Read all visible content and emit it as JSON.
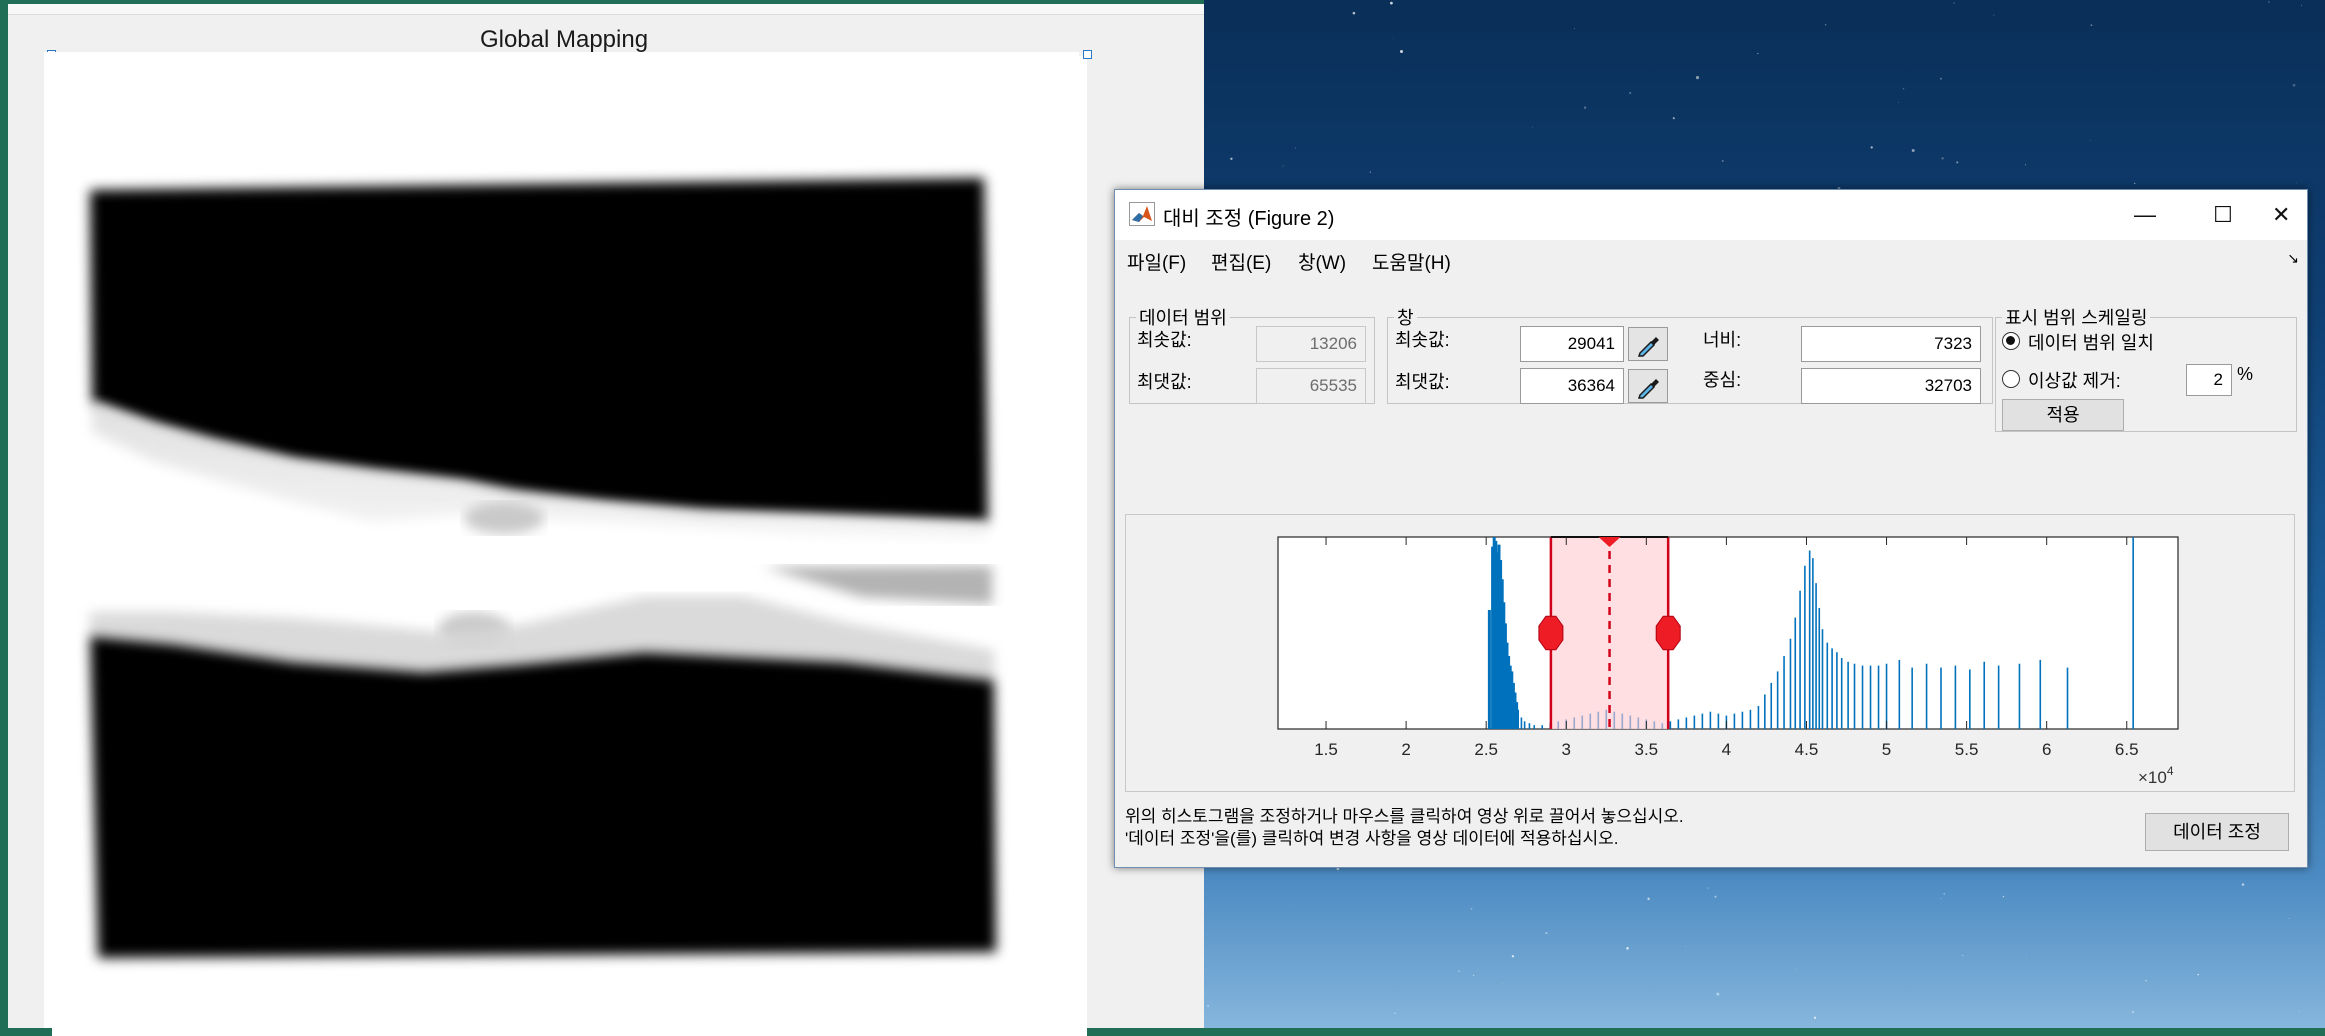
{
  "figure1": {
    "title": "Global Mapping"
  },
  "dialog": {
    "title": "대비 조정 (Figure 2)",
    "window_controls": {
      "minimize": "—",
      "maximize": "☐",
      "close": "✕"
    },
    "menu": [
      "파일(F)",
      "편집(E)",
      "창(W)",
      "도움말(H)"
    ],
    "data_range": {
      "legend": "데이터 범위",
      "min_label": "최솟값:",
      "min_value": "13206",
      "max_label": "최댓값:",
      "max_value": "65535"
    },
    "window": {
      "legend": "창",
      "min_label": "최솟값:",
      "min_value": "29041",
      "max_label": "최댓값:",
      "max_value": "36364",
      "width_label": "너비:",
      "width_value": "7323",
      "center_label": "중심:",
      "center_value": "32703"
    },
    "scaling": {
      "legend": "표시 범위 스케일링",
      "option1": "데이터 범위 일치",
      "option2": "이상값 제거:",
      "outlier_value": "2",
      "percent": "%",
      "apply": "적용",
      "selected": "option1"
    },
    "instructions": [
      "위의 히스토그램을 조정하거나 마우스를 클릭하여 영상 위로 끌어서 놓으십시오.",
      "'데이터 조정'을(를) 클릭하여 변경 사항을 영상 데이터에 적용하십시오."
    ],
    "adjust_button": "데이터 조정"
  },
  "chart_data": {
    "type": "bar",
    "title": "",
    "x_ticks": [
      "1.5",
      "2",
      "2.5",
      "3",
      "3.5",
      "4",
      "4.5",
      "5",
      "5.5",
      "6",
      "6.5"
    ],
    "x_multiplier": "×10",
    "x_multiplier_exp": "4",
    "xlim": [
      12000,
      68200
    ],
    "ylim": [
      0,
      1
    ],
    "window": {
      "min": 29041,
      "max": 36364,
      "center": 32703
    },
    "bar_color": "#0072bd",
    "window_color": "#d0021b",
    "series": [
      {
        "values_xy": [
          [
            25200,
            0.62
          ],
          [
            25400,
            0.95
          ],
          [
            25500,
            1.0
          ],
          [
            25600,
            0.98
          ],
          [
            25700,
            0.92
          ],
          [
            25800,
            0.96
          ],
          [
            25900,
            0.88
          ],
          [
            26000,
            0.78
          ],
          [
            26100,
            0.66
          ],
          [
            26200,
            0.55
          ],
          [
            26300,
            0.45
          ],
          [
            26400,
            0.38
          ],
          [
            26500,
            0.33
          ],
          [
            26600,
            0.3
          ],
          [
            26700,
            0.24
          ],
          [
            26800,
            0.19
          ],
          [
            26900,
            0.14
          ],
          [
            27000,
            0.1
          ],
          [
            27200,
            0.06
          ],
          [
            27400,
            0.04
          ],
          [
            27700,
            0.03
          ],
          [
            28000,
            0.02
          ],
          [
            28500,
            0.02
          ],
          [
            29000,
            0.03
          ],
          [
            29500,
            0.04
          ],
          [
            30000,
            0.05
          ],
          [
            30500,
            0.06
          ],
          [
            31000,
            0.07
          ],
          [
            31500,
            0.08
          ],
          [
            32000,
            0.09
          ],
          [
            32500,
            0.1
          ],
          [
            33000,
            0.09
          ],
          [
            33500,
            0.08
          ],
          [
            34000,
            0.07
          ],
          [
            34500,
            0.06
          ],
          [
            35000,
            0.05
          ],
          [
            35500,
            0.04
          ],
          [
            36000,
            0.03
          ],
          [
            36500,
            0.04
          ],
          [
            37000,
            0.05
          ],
          [
            37500,
            0.06
          ],
          [
            38000,
            0.07
          ],
          [
            38500,
            0.08
          ],
          [
            39000,
            0.09
          ],
          [
            39500,
            0.08
          ],
          [
            40000,
            0.07
          ],
          [
            40500,
            0.08
          ],
          [
            41000,
            0.09
          ],
          [
            41500,
            0.1
          ],
          [
            42000,
            0.12
          ],
          [
            42400,
            0.18
          ],
          [
            42800,
            0.24
          ],
          [
            43200,
            0.3
          ],
          [
            43600,
            0.38
          ],
          [
            44000,
            0.47
          ],
          [
            44300,
            0.58
          ],
          [
            44600,
            0.72
          ],
          [
            44900,
            0.85
          ],
          [
            45200,
            0.93
          ],
          [
            45400,
            0.89
          ],
          [
            45600,
            0.76
          ],
          [
            45800,
            0.63
          ],
          [
            46000,
            0.52
          ],
          [
            46300,
            0.45
          ],
          [
            46600,
            0.42
          ],
          [
            46900,
            0.4
          ],
          [
            47200,
            0.37
          ],
          [
            47600,
            0.35
          ],
          [
            48000,
            0.34
          ],
          [
            48500,
            0.33
          ],
          [
            49000,
            0.33
          ],
          [
            49500,
            0.33
          ],
          [
            50000,
            0.34
          ],
          [
            50800,
            0.36
          ],
          [
            51600,
            0.32
          ],
          [
            52500,
            0.34
          ],
          [
            53400,
            0.32
          ],
          [
            54300,
            0.33
          ],
          [
            55200,
            0.31
          ],
          [
            56100,
            0.35
          ],
          [
            57000,
            0.33
          ],
          [
            58300,
            0.34
          ],
          [
            59600,
            0.36
          ],
          [
            61300,
            0.32
          ],
          [
            65400,
            1.0
          ]
        ]
      }
    ]
  }
}
